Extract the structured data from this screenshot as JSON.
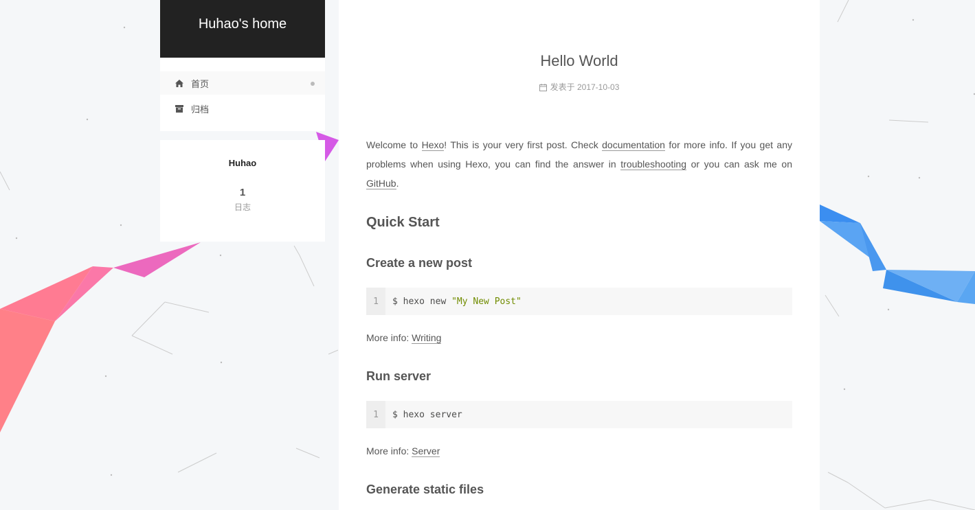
{
  "site": {
    "title": "Huhao's home"
  },
  "menu": [
    {
      "label": "首页",
      "icon": "home-icon",
      "active": true
    },
    {
      "label": "归档",
      "icon": "archive-icon",
      "active": false
    }
  ],
  "author": {
    "name": "Huhao",
    "post_count": "1",
    "post_label": "日志"
  },
  "post": {
    "title": "Hello World",
    "meta_label": "发表于",
    "date": "2017-10-03",
    "intro": {
      "t1": "Welcome to ",
      "link1": "Hexo",
      "t2": "! This is your very first post. Check ",
      "link2": "documentation",
      "t3": " for more info. If you get any problems when using Hexo, you can find the answer in ",
      "link3": "troubleshooting",
      "t4": " or you can ask me on ",
      "link4": "GitHub",
      "t5": "."
    },
    "h_quick_start": "Quick Start",
    "h_create": "Create a new post",
    "code1": {
      "line": "1",
      "cmd": "$ hexo new ",
      "str": "\"My New Post\""
    },
    "more1": {
      "prefix": "More info: ",
      "link": "Writing"
    },
    "h_run": "Run server",
    "code2": {
      "line": "1",
      "cmd": "$ hexo server"
    },
    "more2": {
      "prefix": "More info: ",
      "link": "Server"
    },
    "h_generate": "Generate static files"
  },
  "colors": {
    "brand_bg": "#222222",
    "ribbon_pink": "#f06fb4",
    "ribbon_red": "#ff7b88",
    "ribbon_purple": "#d35ce8",
    "ribbon_blue": "#3d94f0",
    "string_green": "#718c00"
  }
}
